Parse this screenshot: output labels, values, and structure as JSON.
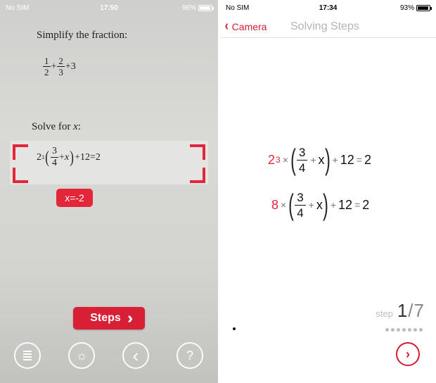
{
  "left": {
    "status": {
      "carrier": "No SIM",
      "time": "17:50",
      "battery": "96%",
      "battery_level": 0.96
    },
    "paper": {
      "q1_title": "Simplify the fraction:",
      "q1_f1_num": "1",
      "q1_f1_den": "2",
      "q1_plus1": "+",
      "q1_f2_num": "2",
      "q1_f2_den": "3",
      "q1_tail": "+3",
      "q2_title_prefix": "Solve for ",
      "q2_title_var": "x",
      "q2_title_suffix": ":",
      "q2_base": "2",
      "q2_exp": "3",
      "q2_open": "(",
      "q2_frac_num": "3",
      "q2_frac_den": "4",
      "q2_mid": "+",
      "q2_var": "x",
      "q2_close": ")",
      "q2_tail": "+12=2"
    },
    "answer": "x=-2",
    "steps_button": {
      "label": "Steps",
      "icon": "double-chevron-right-icon"
    },
    "toolbar": [
      {
        "name": "history-list-button",
        "icon": "list-icon"
      },
      {
        "name": "flash-button",
        "icon": "sun-icon",
        "glyph": "☼"
      },
      {
        "name": "back-button",
        "icon": "chevron-left-icon",
        "glyph": "‹"
      },
      {
        "name": "help-button",
        "icon": "question-icon",
        "glyph": "?"
      }
    ]
  },
  "right": {
    "status": {
      "carrier": "No SIM",
      "time": "17:34",
      "battery": "93%",
      "battery_level": 0.93
    },
    "nav": {
      "back_label": "Camera",
      "title": "Solving Steps"
    },
    "eq1": {
      "base": "2",
      "exp": "3",
      "times": "×",
      "open": "(",
      "frac_num": "3",
      "frac_den": "4",
      "plus": "+",
      "var": "x",
      "close": ")",
      "plus2": "+",
      "const": "12",
      "eq": "=",
      "rhs": "2"
    },
    "eq2": {
      "coef": "8",
      "times": "×",
      "open": "(",
      "frac_num": "3",
      "frac_den": "4",
      "plus": "+",
      "var": "x",
      "close": ")",
      "plus2": "+",
      "const": "12",
      "eq": "=",
      "rhs": "2"
    },
    "step": {
      "label": "step",
      "current": "1",
      "separator": "/",
      "total": "7"
    },
    "page_dots": 7,
    "next_icon": "chevron-right-circle-icon"
  },
  "colors": {
    "accent": "#e3263a",
    "nav_accent": "#d21f33",
    "title_gray": "#b4b4b4"
  }
}
